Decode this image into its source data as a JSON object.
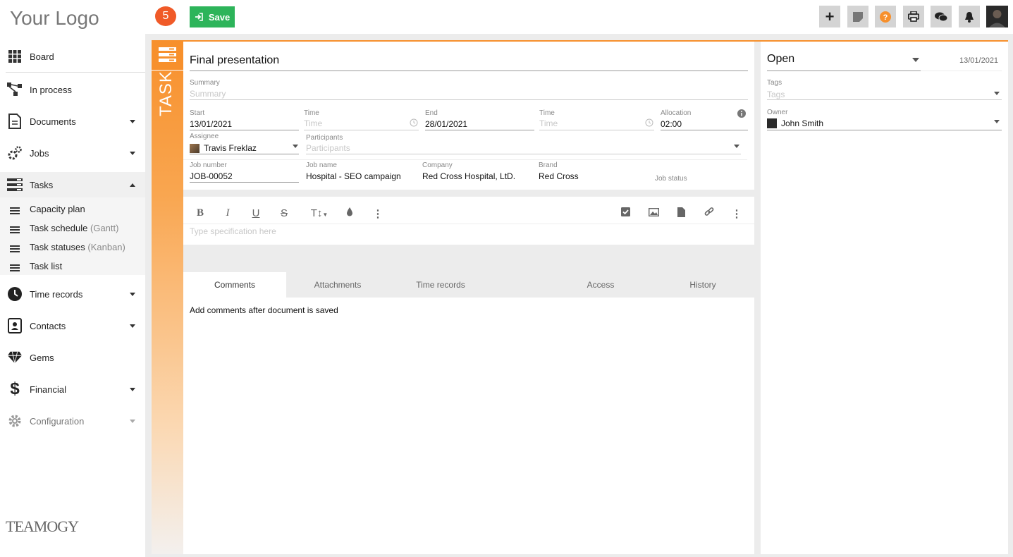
{
  "app": {
    "logo_text": "Your Logo",
    "brand_text": "TEAMOGY"
  },
  "sidebar": {
    "items": [
      {
        "label": "Board"
      },
      {
        "label": "In process"
      },
      {
        "label": "Documents"
      },
      {
        "label": "Jobs"
      },
      {
        "label": "Tasks"
      },
      {
        "label": "Time records"
      },
      {
        "label": "Contacts"
      },
      {
        "label": "Gems"
      },
      {
        "label": "Financial"
      },
      {
        "label": "Configuration"
      }
    ],
    "subitems": [
      {
        "label": "Capacity plan",
        "suffix": ""
      },
      {
        "label": "Task schedule",
        "suffix": "(Gantt)"
      },
      {
        "label": "Task statuses",
        "suffix": "(Kanban)"
      },
      {
        "label": "Task list",
        "suffix": ""
      }
    ]
  },
  "toolbar": {
    "badge_count": "5",
    "save_label": "Save"
  },
  "document": {
    "type_label": "TASK",
    "title": "Final presentation",
    "summary_label": "Summary",
    "summary_placeholder": "Summary",
    "start_label": "Start",
    "start_value": "13/01/2021",
    "time_label": "Time",
    "time_placeholder": "Time",
    "end_label": "End",
    "end_value": "28/01/2021",
    "allocation_label": "Allocation",
    "allocation_value": "02:00",
    "assignee_label": "Assignee",
    "assignee_value": "Travis Freklaz",
    "participants_label": "Participants",
    "participants_placeholder": "Participants",
    "job_number_label": "Job number",
    "job_number_value": "JOB-00052",
    "job_name_label": "Job name",
    "job_name_value": "Hospital - SEO campaign",
    "company_label": "Company",
    "company_value": "Red Cross Hospital, LtD.",
    "brand_label": "Brand",
    "brand_value": "Red Cross",
    "job_status_label": "Job status",
    "spec_placeholder": "Type specification here"
  },
  "tabs": [
    {
      "label": "Comments"
    },
    {
      "label": "Attachments"
    },
    {
      "label": "Time records"
    },
    {
      "label": "Access"
    },
    {
      "label": "History"
    }
  ],
  "comments_message": "Add comments after document is saved",
  "right": {
    "status_value": "Open",
    "date": "13/01/2021",
    "tags_label": "Tags",
    "tags_placeholder": "Tags",
    "owner_label": "Owner",
    "owner_value": "John Smith"
  },
  "colors": {
    "accent": "#f7902c",
    "save": "#2db45a",
    "badge": "#f05a28",
    "help": "#f7902c"
  }
}
